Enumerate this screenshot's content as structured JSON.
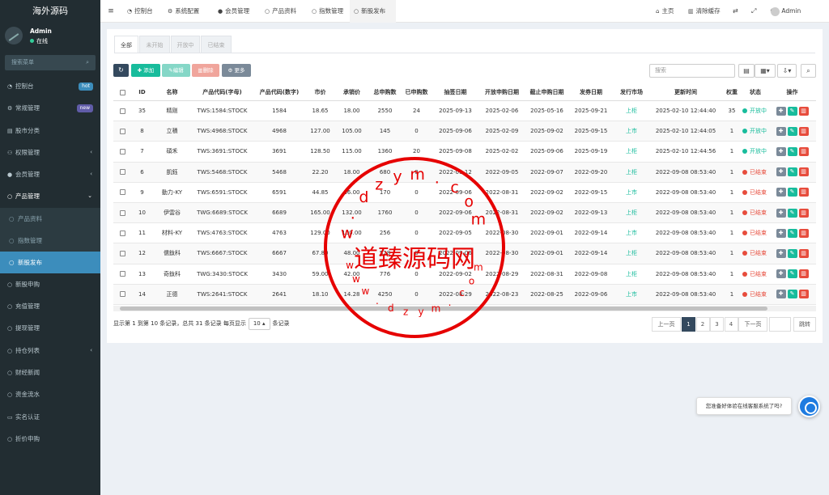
{
  "app": {
    "logo": "海外源码",
    "user": "Admin",
    "status": "在线",
    "search_placeholder": "搜索菜单"
  },
  "sidebar": [
    {
      "label": "控制台",
      "icon": "dashboard-icon",
      "badge": "hot",
      "badge_color": "#3c8dbc"
    },
    {
      "label": "常规管理",
      "icon": "cogs-icon",
      "badge": "new",
      "badge_color": "#605ca8"
    },
    {
      "label": "股市分类",
      "icon": "bars-icon"
    },
    {
      "label": "权限管理",
      "icon": "group-icon",
      "chevron": "‹"
    },
    {
      "label": "会员管理",
      "icon": "user-icon",
      "chevron": "‹"
    },
    {
      "label": "产品管理",
      "icon": "circle-icon",
      "chevron": "⌄",
      "open": true
    },
    {
      "label": "产品资料",
      "icon": "circle-o-icon",
      "sub": true
    },
    {
      "label": "指数管理",
      "icon": "circle-o-icon",
      "sub": true
    },
    {
      "label": "新股发布",
      "icon": "circle-o-icon",
      "sub": true,
      "active": true
    },
    {
      "label": "新股申购",
      "icon": "circle-icon"
    },
    {
      "label": "充值管理",
      "icon": "circle-icon"
    },
    {
      "label": "提现管理",
      "icon": "circle-icon"
    },
    {
      "label": "持仓列表",
      "icon": "circle-icon",
      "chevron": "‹"
    },
    {
      "label": "财经新闻",
      "icon": "circle-icon"
    },
    {
      "label": "资金流水",
      "icon": "circle-icon"
    },
    {
      "label": "实名认证",
      "icon": "id-card-icon"
    },
    {
      "label": "折价申购",
      "icon": "circle-icon"
    }
  ],
  "topnav": [
    {
      "label": "控制台",
      "icon": "dashboard-icon"
    },
    {
      "label": "系统配置",
      "icon": "cog-icon"
    },
    {
      "label": "会员管理",
      "icon": "user-icon"
    },
    {
      "label": "产品资料",
      "icon": "circle-o-icon"
    },
    {
      "label": "指数管理",
      "icon": "circle-o-icon"
    },
    {
      "label": "新股发布",
      "icon": "circle-o-icon",
      "active": true
    }
  ],
  "topright": {
    "home": "主页",
    "clear": "清除缓存",
    "admin": "Admin"
  },
  "tabs": [
    "全部",
    "未开始",
    "开放中",
    "已结束"
  ],
  "toolbar": {
    "refresh": "↻",
    "add": "添加",
    "edit": "编辑",
    "delete": "删除",
    "more": "更多",
    "search_placeholder": "搜索"
  },
  "columns": [
    "ID",
    "名称",
    "产品代码(字母)",
    "产品代码(数字)",
    "市价",
    "承销价",
    "总申购数",
    "已申购数",
    "抽签日期",
    "开放申购日期",
    "截止申购日期",
    "发券日期",
    "发行市场",
    "更新时间",
    "权重",
    "状态",
    "操作"
  ],
  "rows": [
    {
      "id": "35",
      "name": "精刚",
      "code": "TWS:1584:STOCK",
      "num": "1584",
      "price": "18.65",
      "under": "18.00",
      "total": "2550",
      "applied": "24",
      "draw": "2025-09-13",
      "open": "2025-02-06",
      "close": "2025-05-16",
      "issue": "2025-09-21",
      "market": "上柜",
      "updated": "2025-02-10 12:44:40",
      "weight": "35",
      "status": "开放中",
      "status_color": "#18bc9c"
    },
    {
      "id": "8",
      "name": "立積",
      "code": "TWS:4968:STOCK",
      "num": "4968",
      "price": "127.00",
      "under": "105.00",
      "total": "145",
      "applied": "0",
      "draw": "2025-09-06",
      "open": "2025-02-09",
      "close": "2025-09-02",
      "issue": "2025-09-15",
      "market": "上市",
      "updated": "2025-02-10 12:44:05",
      "weight": "1",
      "status": "开放中",
      "status_color": "#18bc9c"
    },
    {
      "id": "7",
      "name": "碩禾",
      "code": "TWS:3691:STOCK",
      "num": "3691",
      "price": "128.50",
      "under": "115.00",
      "total": "1360",
      "applied": "20",
      "draw": "2025-09-08",
      "open": "2025-02-02",
      "close": "2025-09-06",
      "issue": "2025-09-19",
      "market": "上柜",
      "updated": "2025-02-10 12:44:56",
      "weight": "1",
      "status": "开放中",
      "status_color": "#18bc9c"
    },
    {
      "id": "6",
      "name": "凱鈺",
      "code": "TWS:5468:STOCK",
      "num": "5468",
      "price": "22.20",
      "under": "18.00",
      "total": "680",
      "applied": "0",
      "draw": "2022-09-12",
      "open": "2022-09-05",
      "close": "2022-09-07",
      "issue": "2022-09-20",
      "market": "上柜",
      "updated": "2022-09-08 08:53:40",
      "weight": "1",
      "status": "已结束",
      "status_color": "#e74c3c"
    },
    {
      "id": "9",
      "name": "動力-KY",
      "code": "TWS:6591:STOCK",
      "num": "6591",
      "price": "44.85",
      "under": "36.00",
      "total": "170",
      "applied": "0",
      "draw": "2022-09-06",
      "open": "2022-08-31",
      "close": "2022-09-02",
      "issue": "2022-09-15",
      "market": "上市",
      "updated": "2022-09-08 08:53:40",
      "weight": "1",
      "status": "已结束",
      "status_color": "#e74c3c"
    },
    {
      "id": "10",
      "name": "伊雲谷",
      "code": "TWG:6689:STOCK",
      "num": "6689",
      "price": "165.00",
      "under": "132.00",
      "total": "1760",
      "applied": "0",
      "draw": "2022-09-06",
      "open": "2022-08-31",
      "close": "2022-09-02",
      "issue": "2022-09-13",
      "market": "上柜",
      "updated": "2022-09-08 08:53:40",
      "weight": "1",
      "status": "已结束",
      "status_color": "#e74c3c"
    },
    {
      "id": "11",
      "name": "材料-KY",
      "code": "TWS:4763:STOCK",
      "num": "4763",
      "price": "129.00",
      "under": "100.00",
      "total": "256",
      "applied": "0",
      "draw": "2022-09-05",
      "open": "2022-08-30",
      "close": "2022-09-01",
      "issue": "2022-09-14",
      "market": "上市",
      "updated": "2022-09-08 08:53:40",
      "weight": "1",
      "status": "已结束",
      "status_color": "#e74c3c"
    },
    {
      "id": "12",
      "name": "儒鈦科",
      "code": "TWS:6667:STOCK",
      "num": "6667",
      "price": "67.80",
      "under": "48.00",
      "total": "528",
      "applied": "0",
      "draw": "2022-09-06",
      "open": "2022-08-30",
      "close": "2022-09-01",
      "issue": "2022-09-14",
      "market": "上柜",
      "updated": "2022-09-08 08:53:40",
      "weight": "1",
      "status": "已结束",
      "status_color": "#e74c3c"
    },
    {
      "id": "13",
      "name": "奇鈦科",
      "code": "TWG:3430:STOCK",
      "num": "3430",
      "price": "59.00",
      "under": "42.00",
      "total": "776",
      "applied": "0",
      "draw": "2022-09-02",
      "open": "2022-08-29",
      "close": "2022-08-31",
      "issue": "2022-09-08",
      "market": "上柜",
      "updated": "2022-09-08 08:53:40",
      "weight": "1",
      "status": "已结束",
      "status_color": "#e74c3c"
    },
    {
      "id": "14",
      "name": "正德",
      "code": "TWS:2641:STOCK",
      "num": "2641",
      "price": "18.10",
      "under": "14.28",
      "total": "4250",
      "applied": "0",
      "draw": "2022-08-29",
      "open": "2022-08-23",
      "close": "2022-08-25",
      "issue": "2022-09-06",
      "market": "上市",
      "updated": "2022-09-08 08:53:40",
      "weight": "1",
      "status": "已结束",
      "status_color": "#e74c3c"
    }
  ],
  "footer": {
    "summary": "显示第 1 到第 10 条记录，总共 31 条记录 每页显示",
    "perpage": "10 ▴",
    "suffix": "条记录"
  },
  "pagination": {
    "prev": "上一页",
    "pages": [
      "1",
      "2",
      "3",
      "4"
    ],
    "next": "下一页",
    "jump": "跳转"
  },
  "chat": {
    "message": "您准备好体验在线客服系统了吗?"
  },
  "watermark": {
    "brand": "道臻源码网",
    "url_top": "w.dzym.com",
    "url_bottom": "www.dzym.com",
    "color": "#e60000"
  }
}
